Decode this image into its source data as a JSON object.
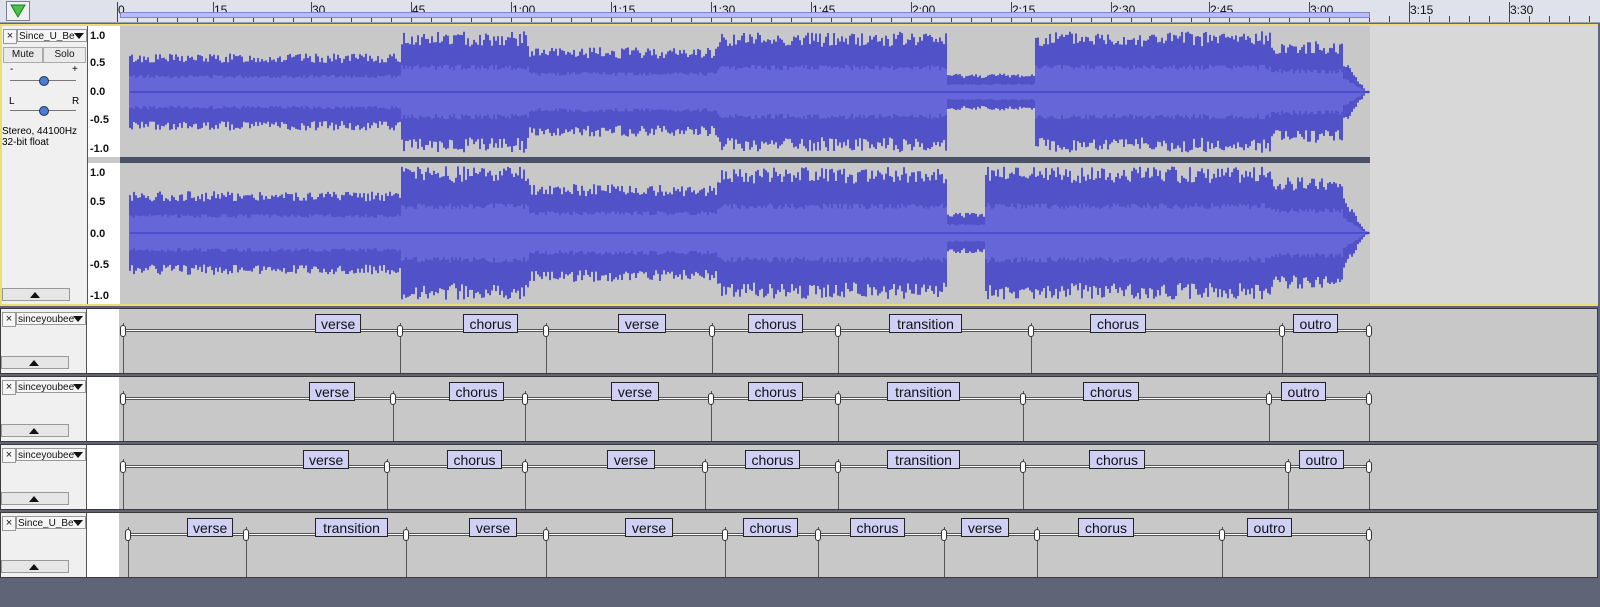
{
  "ruler": {
    "ticks": [
      "0",
      "15",
      "30",
      "45",
      "1:00",
      "1:15",
      "1:30",
      "1:45",
      "2:00",
      "2:15",
      "2:30",
      "2:45",
      "3:00",
      "3:15",
      "3:30"
    ]
  },
  "audio_track": {
    "name": "Since_U_Be",
    "mute_label": "Mute",
    "solo_label": "Solo",
    "gain_minus": "-",
    "gain_plus": "+",
    "pan_left": "L",
    "pan_right": "R",
    "format_line1": "Stereo, 44100Hz",
    "format_line2": "32-bit float",
    "scale": [
      "1.0",
      "0.5",
      "0.0",
      "-0.5",
      "-1.0"
    ]
  },
  "label_tracks": [
    {
      "name": "sinceyoubee",
      "labels": [
        "verse",
        "chorus",
        "verse",
        "chorus",
        "transition",
        "chorus",
        "outro"
      ]
    },
    {
      "name": "sinceyoubee",
      "labels": [
        "verse",
        "chorus",
        "verse",
        "chorus",
        "transition",
        "chorus",
        "outro"
      ]
    },
    {
      "name": "sinceyoubee",
      "labels": [
        "verse",
        "chorus",
        "verse",
        "chorus",
        "transition",
        "chorus",
        "outro"
      ]
    },
    {
      "name": "Since_U_Be",
      "labels": [
        "verse",
        "transition",
        "verse",
        "verse",
        "chorus",
        "chorus",
        "verse",
        "chorus",
        "outro"
      ]
    }
  ],
  "icons": {
    "close": "close-icon",
    "dropdown": "chevron-down-icon",
    "collapse": "chevron-up-icon",
    "play_head": "play-head-icon"
  },
  "colors": {
    "waveform_peak": "#3434c8",
    "waveform_rms": "#6464dc",
    "track_bg": "#c8c8c8",
    "label_fill": "#cfd0f4",
    "selection_border": "#e8e070"
  }
}
